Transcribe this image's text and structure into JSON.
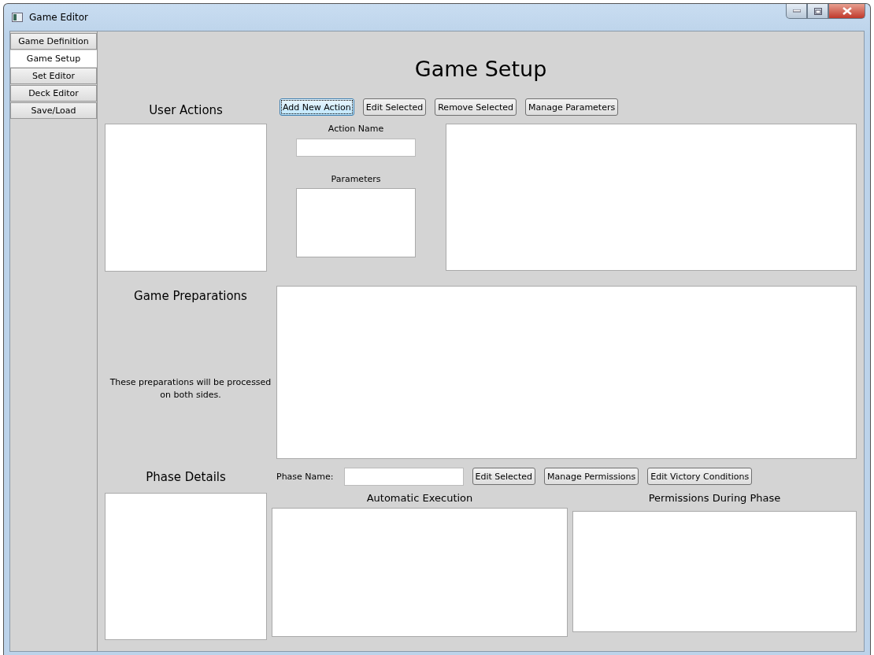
{
  "window": {
    "title": "Game Editor"
  },
  "tabs": [
    {
      "label": "Game Definition",
      "selected": false
    },
    {
      "label": "Game Setup",
      "selected": true
    },
    {
      "label": "Set Editor",
      "selected": false
    },
    {
      "label": "Deck Editor",
      "selected": false
    },
    {
      "label": "Save/Load",
      "selected": false
    }
  ],
  "heading": "Game Setup",
  "user_actions": {
    "label": "User Actions",
    "buttons": [
      {
        "label": "Add New Action",
        "focused": true
      },
      {
        "label": "Edit Selected",
        "focused": false
      },
      {
        "label": "Remove Selected",
        "focused": false
      },
      {
        "label": "Manage Parameters",
        "focused": false
      }
    ],
    "action_name_label": "Action Name",
    "parameters_label": "Parameters"
  },
  "game_preparations": {
    "label": "Game Preparations",
    "note": "These preparations will be processed on both sides."
  },
  "phase_details": {
    "label": "Phase Details",
    "phase_name_label": "Phase Name:",
    "buttons": [
      {
        "label": "Edit Selected",
        "focused": false
      },
      {
        "label": "Manage Permissions",
        "focused": false
      },
      {
        "label": "Edit Victory Conditions",
        "focused": false
      }
    ],
    "automatic_execution_label": "Automatic Execution",
    "permissions_label": "Permissions During Phase"
  }
}
